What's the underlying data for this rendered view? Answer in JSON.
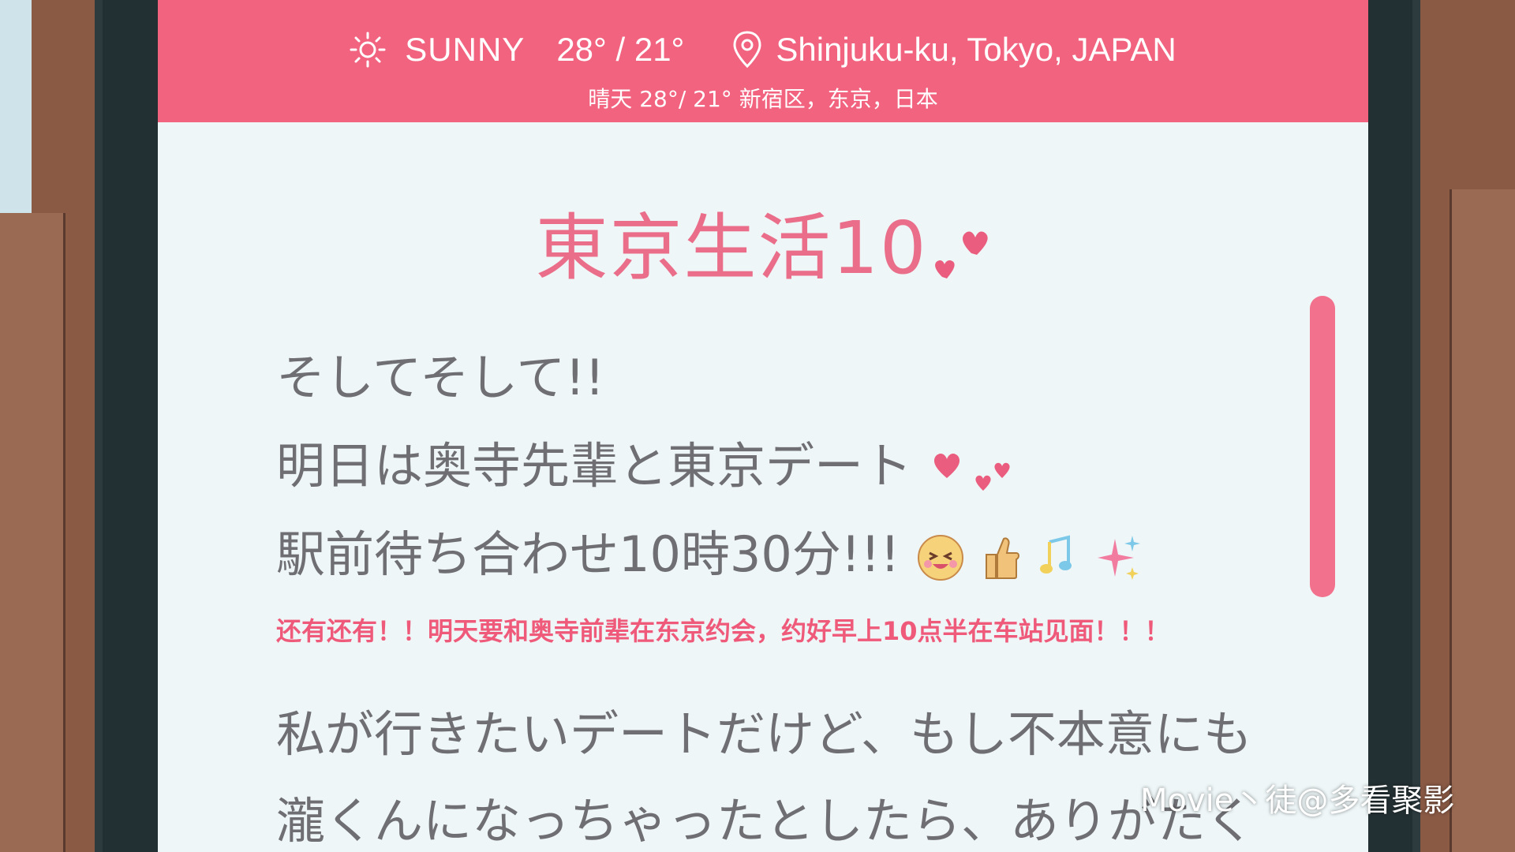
{
  "weather_bar": {
    "condition": "SUNNY",
    "temperature": "28° / 21°",
    "location": "Shinjuku-ku, Tokyo, JAPAN",
    "subtitle": "晴天  28°/ 21°  新宿区，东京，日本",
    "condition_icon": "sun-icon",
    "location_icon": "map-pin-icon",
    "bar_color": "#f1637f"
  },
  "post": {
    "title": "東京生活10",
    "title_color": "#ea6e8a",
    "lines": [
      "そしてそして!!",
      "明日は奥寺先輩と東京デート",
      "駅前待ち合わせ10時30分!!!",
      "私が行きたいデートだけど、もし不本意にも",
      "瀧くんになっちゃったとしたら、ありがたく"
    ],
    "translation_subtitle": "还有还有！！明天要和奥寺前辈在东京约会，约好早上10点半在车站见面！！！",
    "text_color": "#6f6f73",
    "subtitle_color": "#ef5a7a"
  },
  "scrollbar": {
    "color": "#f2718d"
  },
  "credit": "Movie丶徒@多看聚影"
}
